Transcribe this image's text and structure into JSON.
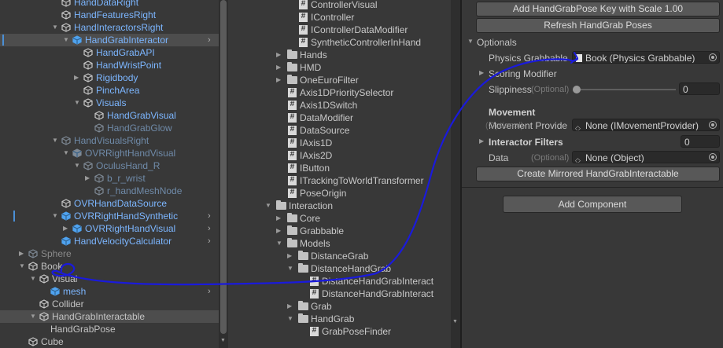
{
  "hierarchy": {
    "items": [
      {
        "label": "HandDataRight",
        "depth": 3,
        "icon": "gameobject",
        "fold": "none",
        "color": "blue"
      },
      {
        "label": "HandFeaturesRight",
        "depth": 3,
        "icon": "gameobject",
        "fold": "none",
        "color": "blue"
      },
      {
        "label": "HandInteractorsRight",
        "depth": 3,
        "icon": "gameobject",
        "fold": "open",
        "color": "blue"
      },
      {
        "label": "HandGrabInteractor",
        "depth": 4,
        "icon": "prefab-blue",
        "fold": "open",
        "color": "blue",
        "selected": true,
        "arrow": true,
        "marker": true
      },
      {
        "label": "HandGrabAPI",
        "depth": 5,
        "icon": "gameobject",
        "fold": "none",
        "color": "blue"
      },
      {
        "label": "HandWristPoint",
        "depth": 5,
        "icon": "gameobject",
        "fold": "none",
        "color": "blue"
      },
      {
        "label": "Rigidbody",
        "depth": 5,
        "icon": "gameobject",
        "fold": "closed",
        "color": "blue"
      },
      {
        "label": "PinchArea",
        "depth": 5,
        "icon": "gameobject",
        "fold": "none",
        "color": "blue"
      },
      {
        "label": "Visuals",
        "depth": 5,
        "icon": "gameobject",
        "fold": "open",
        "color": "blue"
      },
      {
        "label": "HandGrabVisual",
        "depth": 6,
        "icon": "gameobject",
        "fold": "none",
        "color": "blue"
      },
      {
        "label": "HandGrabGlow",
        "depth": 6,
        "icon": "gameobject",
        "fold": "none",
        "color": "dim"
      },
      {
        "label": "HandVisualsRight",
        "depth": 3,
        "icon": "gameobject",
        "fold": "open",
        "color": "dim"
      },
      {
        "label": "OVRRightHandVisual",
        "depth": 4,
        "icon": "prefab-dim",
        "fold": "open",
        "color": "dim"
      },
      {
        "label": "OculusHand_R",
        "depth": 5,
        "icon": "gameobject",
        "fold": "open",
        "color": "dim"
      },
      {
        "label": "b_r_wrist",
        "depth": 6,
        "icon": "gameobject",
        "fold": "closed",
        "color": "dim"
      },
      {
        "label": "r_handMeshNode",
        "depth": 6,
        "icon": "gameobject",
        "fold": "none",
        "color": "dim"
      },
      {
        "label": "OVRHandDataSource",
        "depth": 3,
        "icon": "gameobject",
        "fold": "none",
        "color": "blue"
      },
      {
        "label": "OVRRightHandSynthetic",
        "depth": 3,
        "icon": "prefab-blue",
        "fold": "open",
        "color": "blue",
        "arrow": true,
        "marker": true
      },
      {
        "label": "OVRRightHandVisual",
        "depth": 4,
        "icon": "prefab-blue",
        "fold": "closed",
        "color": "blue",
        "arrow": true
      },
      {
        "label": "HandVelocityCalculator",
        "depth": 3,
        "icon": "prefab-blue",
        "fold": "none",
        "color": "blue",
        "arrow": true
      },
      {
        "label": "Sphere",
        "depth": 0,
        "icon": "gameobject",
        "fold": "closed",
        "color": "grey"
      },
      {
        "label": "Book",
        "depth": 0,
        "icon": "gameobject",
        "fold": "open",
        "color": "white"
      },
      {
        "label": "Visual",
        "depth": 1,
        "icon": "gameobject",
        "fold": "open",
        "color": "white"
      },
      {
        "label": "mesh",
        "depth": 2,
        "icon": "prefab-blue",
        "fold": "none",
        "color": "blue",
        "arrow": true
      },
      {
        "label": "Collider",
        "depth": 1,
        "icon": "gameobject",
        "fold": "none",
        "color": "white"
      },
      {
        "label": "HandGrabInteractable",
        "depth": 1,
        "icon": "gameobject",
        "fold": "open",
        "color": "white",
        "selected": true
      },
      {
        "label": "HandGrabPose",
        "depth": 2,
        "icon": "none",
        "fold": "none",
        "color": "white"
      },
      {
        "label": "Cube",
        "depth": 0,
        "icon": "gameobject",
        "fold": "none",
        "color": "white"
      }
    ]
  },
  "project": {
    "items": [
      {
        "label": "ControllerVisual",
        "depth": 2,
        "type": "script",
        "fold": "none"
      },
      {
        "label": "IController",
        "depth": 2,
        "type": "script",
        "fold": "none"
      },
      {
        "label": "IControllerDataModifier",
        "depth": 2,
        "type": "script",
        "fold": "none"
      },
      {
        "label": "SyntheticControllerInHand",
        "depth": 2,
        "type": "script",
        "fold": "none"
      },
      {
        "label": "Hands",
        "depth": 1,
        "type": "folder",
        "fold": "closed"
      },
      {
        "label": "HMD",
        "depth": 1,
        "type": "folder",
        "fold": "closed"
      },
      {
        "label": "OneEuroFilter",
        "depth": 1,
        "type": "folder",
        "fold": "closed"
      },
      {
        "label": "Axis1DPrioritySelector",
        "depth": 1,
        "type": "script",
        "fold": "none"
      },
      {
        "label": "Axis1DSwitch",
        "depth": 1,
        "type": "script",
        "fold": "none"
      },
      {
        "label": "DataModifier",
        "depth": 1,
        "type": "script",
        "fold": "none"
      },
      {
        "label": "DataSource",
        "depth": 1,
        "type": "script",
        "fold": "none"
      },
      {
        "label": "IAxis1D",
        "depth": 1,
        "type": "script",
        "fold": "none"
      },
      {
        "label": "IAxis2D",
        "depth": 1,
        "type": "script",
        "fold": "none"
      },
      {
        "label": "IButton",
        "depth": 1,
        "type": "script",
        "fold": "none"
      },
      {
        "label": "ITrackingToWorldTransformer",
        "depth": 1,
        "type": "script",
        "fold": "none"
      },
      {
        "label": "PoseOrigin",
        "depth": 1,
        "type": "script",
        "fold": "none"
      },
      {
        "label": "Interaction",
        "depth": 0,
        "type": "folder",
        "fold": "open"
      },
      {
        "label": "Core",
        "depth": 1,
        "type": "folder",
        "fold": "closed"
      },
      {
        "label": "Grabbable",
        "depth": 1,
        "type": "folder",
        "fold": "closed"
      },
      {
        "label": "Models",
        "depth": 1,
        "type": "folder",
        "fold": "open"
      },
      {
        "label": "DistanceGrab",
        "depth": 2,
        "type": "folder",
        "fold": "closed"
      },
      {
        "label": "DistanceHandGrab",
        "depth": 2,
        "type": "folder",
        "fold": "open"
      },
      {
        "label": "DistanceHandGrabInteract",
        "depth": 3,
        "type": "script",
        "fold": "none"
      },
      {
        "label": "DistanceHandGrabInteract",
        "depth": 3,
        "type": "script",
        "fold": "none"
      },
      {
        "label": "Grab",
        "depth": 2,
        "type": "folder",
        "fold": "closed"
      },
      {
        "label": "HandGrab",
        "depth": 2,
        "type": "folder",
        "fold": "open"
      },
      {
        "label": "GrabPoseFinder",
        "depth": 3,
        "type": "script",
        "fold": "none"
      }
    ]
  },
  "inspector": {
    "add_key_button": "Add HandGrabPose Key with Scale 1.00",
    "refresh_button": "Refresh HandGrab Poses",
    "optionals_header": "Optionals",
    "physics_grabbable_label": "Physics Grabbable",
    "physics_grabbable_value": "Book (Physics Grabbable)",
    "scoring_modifier_label": "Scoring Modifier",
    "slippiness_label": "Slippiness",
    "slippiness_optional": "(Optional)",
    "slippiness_value": "0",
    "movement_header": "Movement",
    "movement_provider_label": "Movement Provide",
    "movement_provider_optional": "(Optional)",
    "movement_provider_value": "None (IMovementProvider)",
    "interactor_filters_label": "Interactor Filters",
    "interactor_filters_value": "0",
    "data_label": "Data",
    "data_optional": "(Optional)",
    "data_value": "None (Object)",
    "mirrored_button": "Create Mirrored HandGrabInteractable",
    "add_component_button": "Add Component"
  },
  "colors": {
    "annotation_stroke": "#1a1adc",
    "prefab_blue": "#7cb6ff",
    "selection_bg": "#4d4d4d"
  }
}
